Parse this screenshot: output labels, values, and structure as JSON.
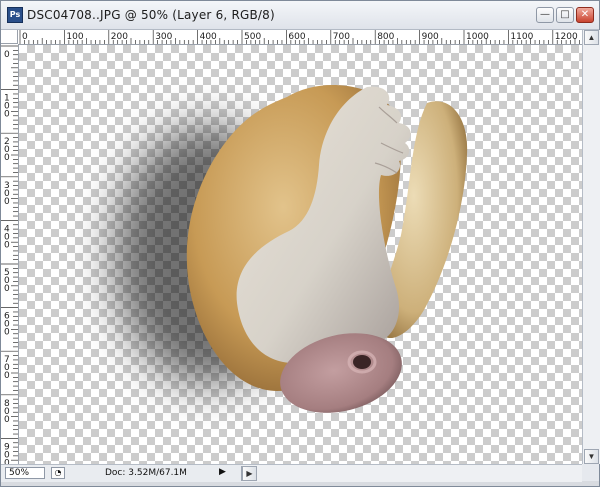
{
  "window": {
    "app_icon_label": "Ps",
    "title": "DSC04708..JPG @ 50% (Layer 6, RGB/8)",
    "minimize_glyph": "—",
    "maximize_glyph": "□",
    "close_glyph": "✕"
  },
  "ruler_horizontal": [
    "0",
    "100",
    "200",
    "300",
    "400",
    "500",
    "600",
    "700",
    "800",
    "900",
    "1000",
    "1100",
    "1200"
  ],
  "ruler_vertical": [
    "0",
    "100",
    "200",
    "300",
    "400",
    "500",
    "600",
    "700",
    "800",
    "900"
  ],
  "status": {
    "zoom": "50%",
    "doc_info": "Doc: 3.52M/67.1M",
    "menu_arrow": "▶"
  },
  "colors": {
    "bread": "#c9a15a",
    "skin": "#d9d3c8",
    "ham": "#b98f91"
  }
}
